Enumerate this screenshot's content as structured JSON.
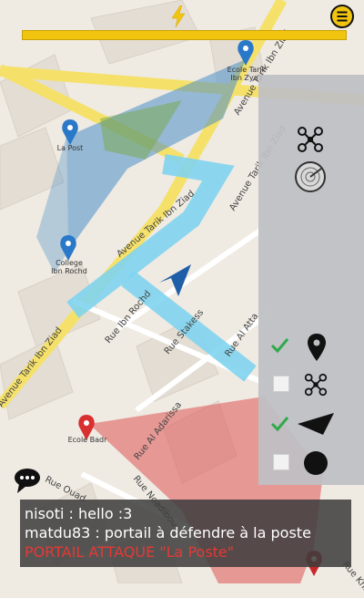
{
  "map": {
    "pois": [
      {
        "label": "Ecole Tarik Ibn Zyad",
        "line1": "Ecole Tarik",
        "line2": "Ibn Zyad"
      },
      {
        "label": "La Post"
      },
      {
        "label": "College Ibn Rochd",
        "line1": "College",
        "line2": "Ibn Rochd"
      },
      {
        "label": "Ecole Badr"
      }
    ],
    "streets": [
      "Avenue Tarik Ibn Ziad",
      "Avenue Tarik Ibn Ziad",
      "Avenue Tarik Ibn Ziad",
      "Avenue Tarik Ibn Ziad",
      "Rue Ibn Rochd",
      "Rue Stakess",
      "Rue Al Atta",
      "Rue Al Adarissa",
      "Rue Noadibou",
      "Rue Ouad",
      "Rue Khat"
    ]
  },
  "toolbar": {
    "energy_icon": "lightning-icon",
    "menu_icon": "menu-icon"
  },
  "panel": {
    "top_icons": [
      "drone-icon",
      "radar-icon"
    ],
    "filters": [
      {
        "name": "filter-marker",
        "checked": true,
        "icon": "map-marker-icon"
      },
      {
        "name": "filter-drone",
        "checked": false,
        "icon": "drone-icon"
      },
      {
        "name": "filter-direction",
        "checked": true,
        "icon": "arrow-icon"
      },
      {
        "name": "filter-circle",
        "checked": false,
        "icon": "circle-icon"
      }
    ]
  },
  "chat": {
    "messages": [
      {
        "text": "nisoti : hello :3"
      },
      {
        "text": "matdu83 : portail à défendre à la poste"
      }
    ],
    "alert": "PORTAIL ATTAQUE \"La Poste\""
  },
  "colors": {
    "accent": "#f1c40f",
    "blue_zone": "#4a90c8",
    "red_zone": "#e57373",
    "check": "#2eaa4a"
  }
}
